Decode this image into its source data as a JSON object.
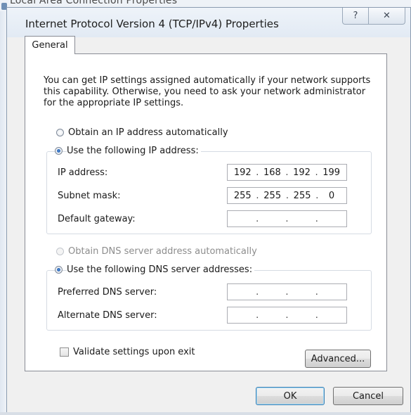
{
  "background_window": {
    "title": "Local Area Connection Properties"
  },
  "dialog": {
    "title": "Internet Protocol Version 4 (TCP/IPv4) Properties",
    "help_glyph": "?",
    "close_glyph": "✕"
  },
  "tabs": [
    {
      "label": "General",
      "selected": true
    }
  ],
  "intro_text": "You can get IP settings assigned automatically if your network supports this capability. Otherwise, you need to ask your network administrator for the appropriate IP settings.",
  "ip_settings": {
    "auto_option": {
      "label": "Obtain an IP address automatically",
      "selected": false
    },
    "manual_option": {
      "label": "Use the following IP address:",
      "selected": true
    },
    "fields": [
      {
        "label": "IP address:",
        "octets": [
          "192",
          "168",
          "192",
          "199"
        ]
      },
      {
        "label": "Subnet mask:",
        "octets": [
          "255",
          "255",
          "255",
          "0"
        ]
      },
      {
        "label": "Default gateway:",
        "octets": [
          "",
          "",
          "",
          ""
        ]
      }
    ]
  },
  "dns_settings": {
    "auto_option": {
      "label": "Obtain DNS server address automatically",
      "selected": false,
      "disabled": true
    },
    "manual_option": {
      "label": "Use the following DNS server addresses:",
      "selected": true
    },
    "fields": [
      {
        "label": "Preferred DNS server:",
        "octets": [
          "",
          "",
          "",
          ""
        ]
      },
      {
        "label": "Alternate DNS server:",
        "octets": [
          "",
          "",
          "",
          ""
        ]
      }
    ]
  },
  "validate_checkbox": {
    "label": "Validate settings upon exit",
    "checked": false
  },
  "buttons": {
    "advanced": "Advanced...",
    "ok": "OK",
    "cancel": "Cancel"
  },
  "colors": {
    "dialog_bg": "#f0f0f0",
    "panel_bg": "#ffffff",
    "radio_fill": "#1f5aa8",
    "title_bar": "#e2eaf4"
  }
}
